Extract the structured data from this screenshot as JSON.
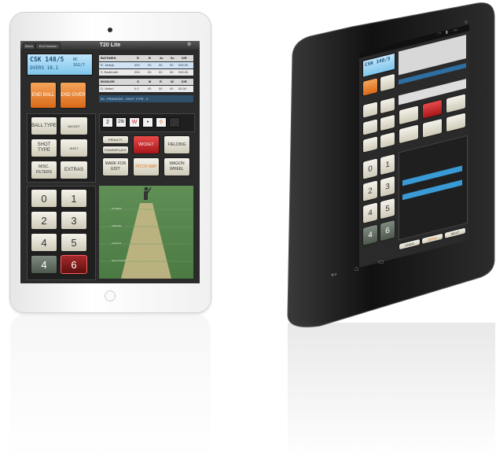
{
  "ipad_app": {
    "title": "T20 Lite",
    "menu_label": "Menu",
    "session_label": "End Session",
    "score": {
      "team_score": "CSK  148/5",
      "overs": "OVERS  18.1",
      "target": "RC  162/7"
    },
    "actions": {
      "end_ball": "END BALL",
      "end_over": "END OVER"
    },
    "batsmen_table": {
      "headers": [
        "BATSMEN",
        "R",
        "B",
        "4s",
        "6s",
        "S/R"
      ],
      "rows": [
        [
          "R. Jadeja",
          "000",
          "00",
          "00",
          "00",
          "000.00"
        ],
        [
          "S. Badrinath",
          "000",
          "00",
          "00",
          "00",
          "000.00"
        ]
      ]
    },
    "bowler_table": {
      "headers": [
        "BOWLER",
        "O",
        "M",
        "R",
        "W",
        "E/R"
      ],
      "rows": [
        [
          "D. Vettori",
          "0.0",
          "00",
          "00",
          "00",
          "00.00"
        ]
      ]
    },
    "info_bar": "00 - PRAMODH - SHOT TYPE - 0",
    "left_buttons": [
      {
        "label": "BALL TYPE",
        "toggle": "WICKET"
      },
      {
        "label": "SHOT TYPE",
        "toggle": "SHOT"
      },
      {
        "label": "MISC. FILTERS",
        "toggle": "EXTRAS"
      }
    ],
    "ball_chips": [
      "2",
      "2lb",
      "W",
      "•",
      "6",
      ""
    ],
    "mid_buttons": [
      "PENALTY",
      "WICKET",
      "FIELDING",
      "POWERPLAYS",
      "MARK FOR EDIT",
      "PITCH MAP",
      "WAGON WHEEL"
    ],
    "keypad": [
      "0",
      "1",
      "2",
      "3",
      "4",
      "5",
      "4",
      "6"
    ],
    "field_labels": [
      "STUMPS",
      "CREASE",
      "LENGTH",
      "HALF VOLLEY"
    ],
    "colors": {
      "lcd_blue": "#7fc6ec",
      "orange": "#e0782a",
      "red": "#c62828",
      "cream": "#e8e5d8"
    }
  },
  "tablet_app": {
    "score": "CSK  148/5",
    "status_icons": [
      "wifi-icon",
      "signal-icon",
      "battery-icon"
    ],
    "tabs": [
      "UNDO",
      "MENU",
      "NEXT"
    ],
    "keypad": [
      "0",
      "1",
      "2",
      "3",
      "4",
      "5",
      "4",
      "6"
    ],
    "nav_icons": [
      "back-icon",
      "home-icon",
      "recents-icon"
    ]
  }
}
